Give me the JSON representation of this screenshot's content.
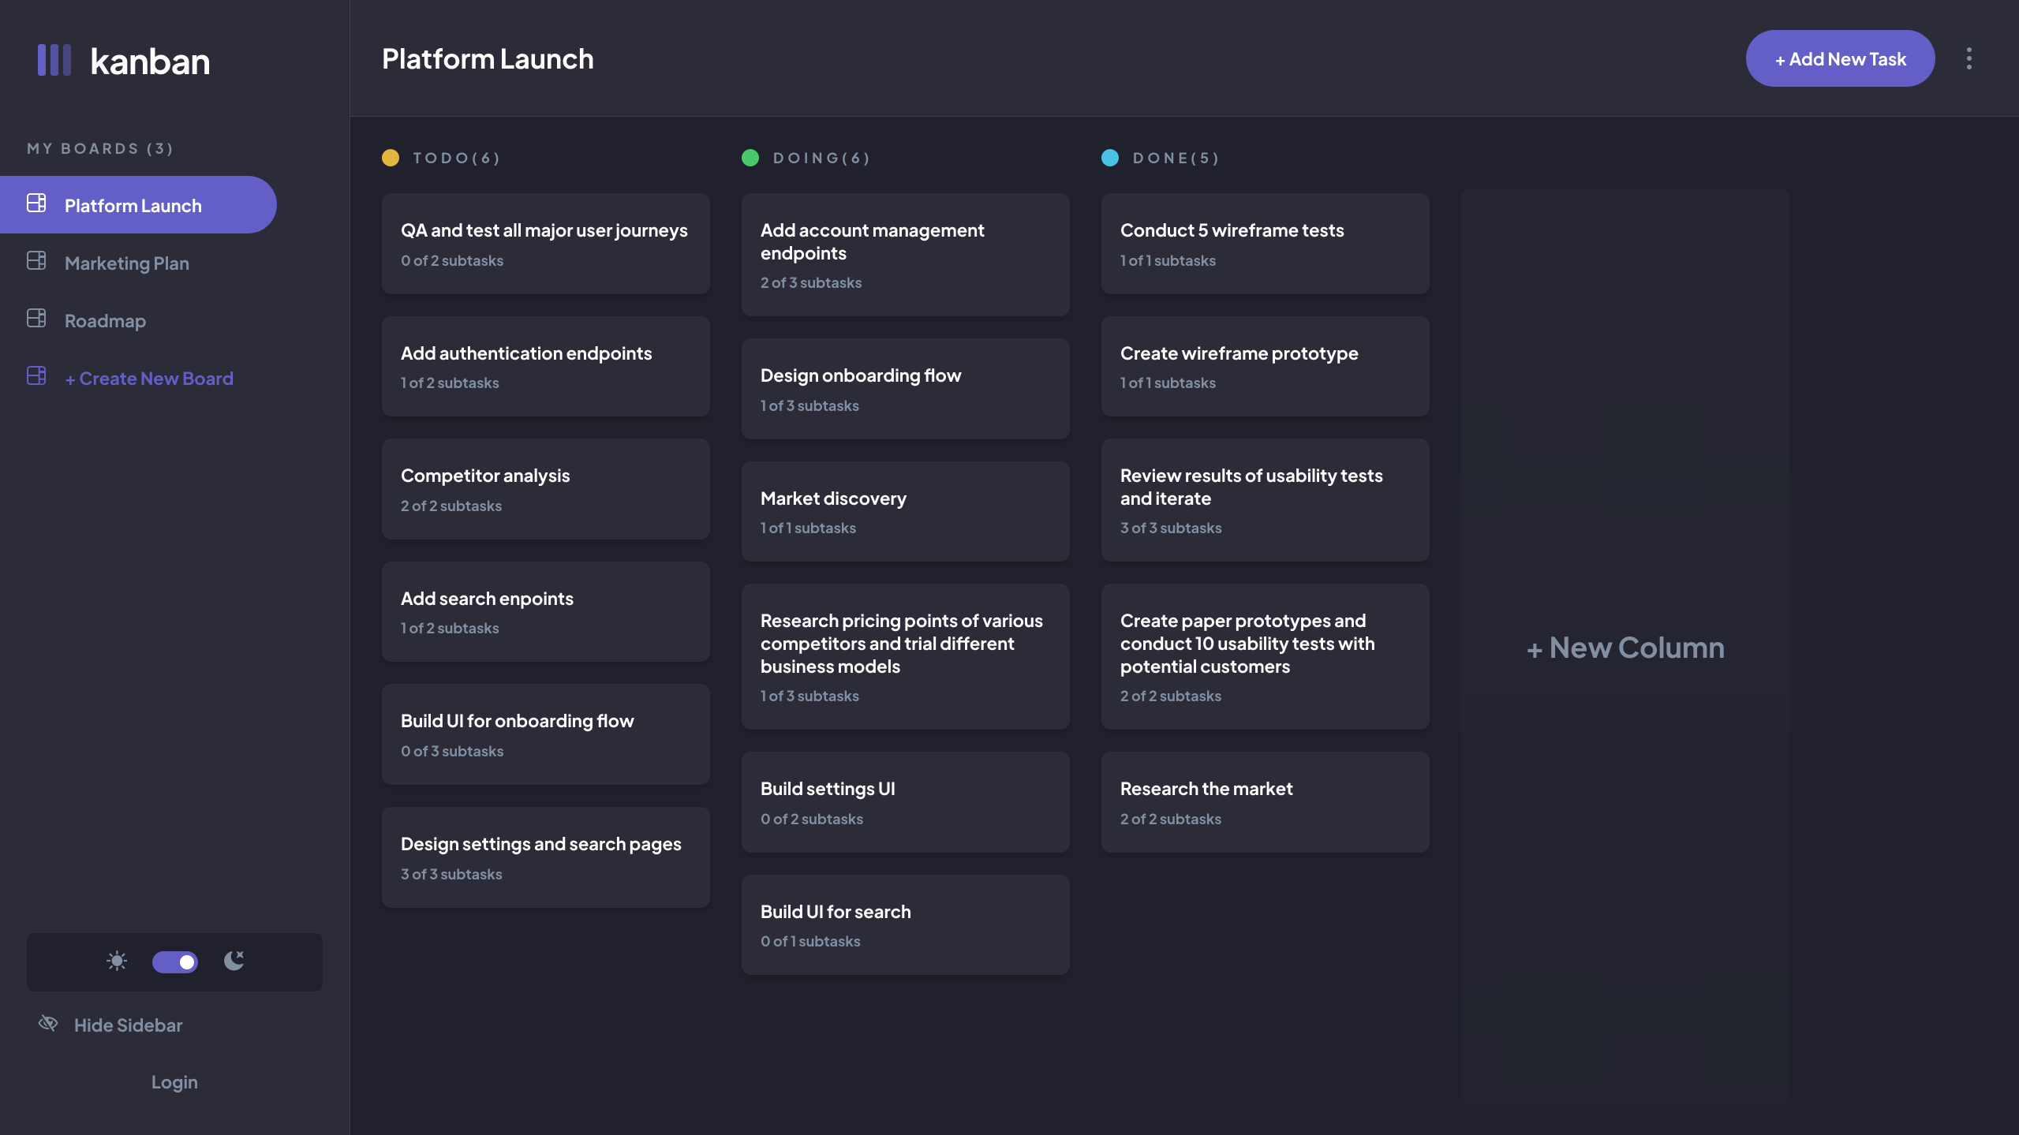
{
  "app": {
    "name": "kanban"
  },
  "sidebar": {
    "heading": "MY BOARDS (3)",
    "boards": [
      {
        "label": "Platform Launch"
      },
      {
        "label": "Marketing Plan"
      },
      {
        "label": "Roadmap"
      }
    ],
    "create_label": "+ Create New Board",
    "hide_label": "Hide Sidebar",
    "login_label": "Login"
  },
  "header": {
    "title": "Platform Launch",
    "add_task_label": "+ Add New Task"
  },
  "columns": [
    {
      "name": "TODO",
      "count": 6,
      "color": "#E2B53F",
      "cards": [
        {
          "title": "QA and test all major user journeys",
          "subtasks": "0 of 2 subtasks"
        },
        {
          "title": "Add authentication endpoints",
          "subtasks": "1 of 2 subtasks"
        },
        {
          "title": "Competitor analysis",
          "subtasks": "2 of 2 subtasks"
        },
        {
          "title": "Add search enpoints",
          "subtasks": "1 of 2 subtasks"
        },
        {
          "title": "Build UI for onboarding flow",
          "subtasks": "0 of 3 subtasks"
        },
        {
          "title": "Design settings and search pages",
          "subtasks": "3 of 3 subtasks"
        }
      ]
    },
    {
      "name": "DOING",
      "count": 6,
      "color": "#49C4E5",
      "second_color": "#67E2AE",
      "cards": [
        {
          "title": "Add account management endpoints",
          "subtasks": "2 of 3 subtasks"
        },
        {
          "title": "Design onboarding flow",
          "subtasks": "1 of 3 subtasks"
        },
        {
          "title": "Market discovery",
          "subtasks": "1 of 1 subtasks"
        },
        {
          "title": "Research pricing points of various competitors and trial different business models",
          "subtasks": "1 of 3 subtasks"
        },
        {
          "title": "Build settings UI",
          "subtasks": "0 of 2 subtasks"
        },
        {
          "title": "Build UI for search",
          "subtasks": "0 of 1 subtasks"
        }
      ]
    },
    {
      "name": "DONE",
      "count": 5,
      "color": "#67E2AE",
      "cards": [
        {
          "title": "Conduct 5 wireframe tests",
          "subtasks": "1 of 1 subtasks"
        },
        {
          "title": "Create wireframe prototype",
          "subtasks": "1 of 1 subtasks"
        },
        {
          "title": "Review results of usability tests and iterate",
          "subtasks": "3 of 3 subtasks"
        },
        {
          "title": "Create paper prototypes and conduct 10 usability tests with potential customers",
          "subtasks": "2 of 2 subtasks"
        },
        {
          "title": "Research the market",
          "subtasks": "2 of 2 subtasks"
        }
      ]
    }
  ],
  "new_column_label": "+ New Column"
}
